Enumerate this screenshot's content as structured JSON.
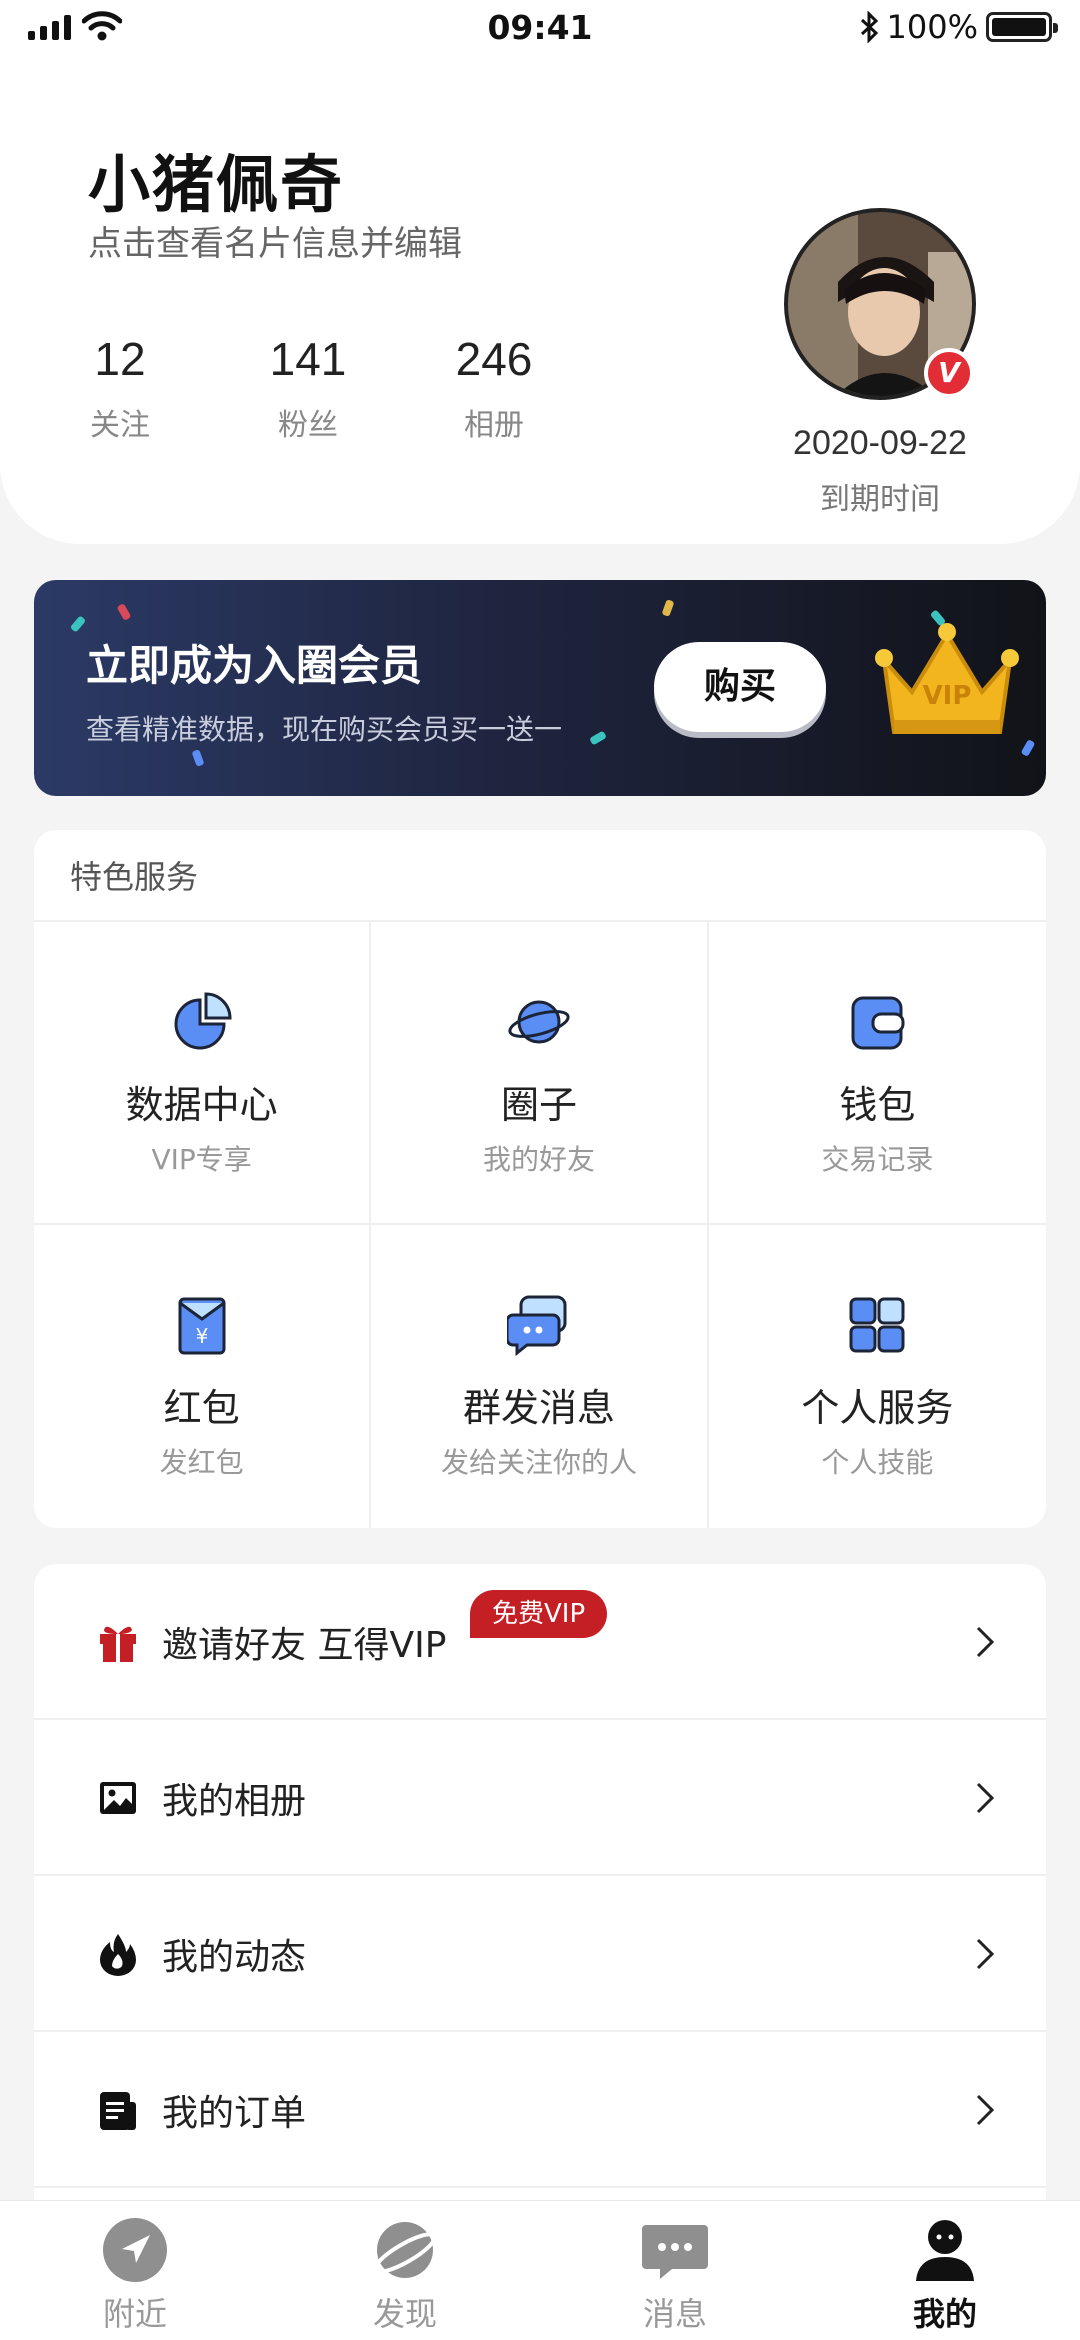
{
  "status_bar": {
    "time": "09:41",
    "battery": "100%",
    "icons": [
      "signal-icon",
      "wifi-icon",
      "bluetooth-icon",
      "battery-icon"
    ]
  },
  "profile": {
    "name": "小猪佩奇",
    "subtitle": "点击查看名片信息并编辑",
    "stats": [
      {
        "value": "12",
        "label": "关注"
      },
      {
        "value": "141",
        "label": "粉丝"
      },
      {
        "value": "246",
        "label": "相册"
      }
    ],
    "badge": "V",
    "expire_date": "2020-09-22",
    "expire_label": "到期时间"
  },
  "vip_banner": {
    "title": "立即成为入圈会员",
    "subtitle": "查看精准数据，现在购买会员买一送一",
    "buy_label": "购买",
    "crown_text": "VIP"
  },
  "services": {
    "title": "特色服务",
    "items": [
      {
        "label": "数据中心",
        "sub": "VIP专享",
        "icon": "pie-chart-icon"
      },
      {
        "label": "圈子",
        "sub": "我的好友",
        "icon": "planet-icon"
      },
      {
        "label": "钱包",
        "sub": "交易记录",
        "icon": "wallet-icon"
      },
      {
        "label": "红包",
        "sub": "发红包",
        "icon": "red-envelope-icon"
      },
      {
        "label": "群发消息",
        "sub": "发给关注你的人",
        "icon": "chat-bubbles-icon"
      },
      {
        "label": "个人服务",
        "sub": "个人技能",
        "icon": "grid-icon"
      }
    ]
  },
  "menu": {
    "items": [
      {
        "label": "邀请好友 互得VIP",
        "icon": "gift-icon",
        "badge": "免费VIP"
      },
      {
        "label": "我的相册",
        "icon": "image-icon"
      },
      {
        "label": "我的动态",
        "icon": "flame-icon"
      },
      {
        "label": "我的订单",
        "icon": "order-icon"
      }
    ]
  },
  "tab_bar": {
    "items": [
      {
        "label": "附近",
        "icon": "location-arrow-icon",
        "active": false
      },
      {
        "label": "发现",
        "icon": "planet-icon",
        "active": false
      },
      {
        "label": "消息",
        "icon": "message-icon",
        "active": false
      },
      {
        "label": "我的",
        "icon": "user-icon",
        "active": true
      }
    ]
  },
  "colors": {
    "accent_blue": "#5b8ef5",
    "vip_red": "#c41f24",
    "badge_red": "#e22d36",
    "banner_dark": "#1f2540",
    "crown_gold": "#f2b51e"
  }
}
